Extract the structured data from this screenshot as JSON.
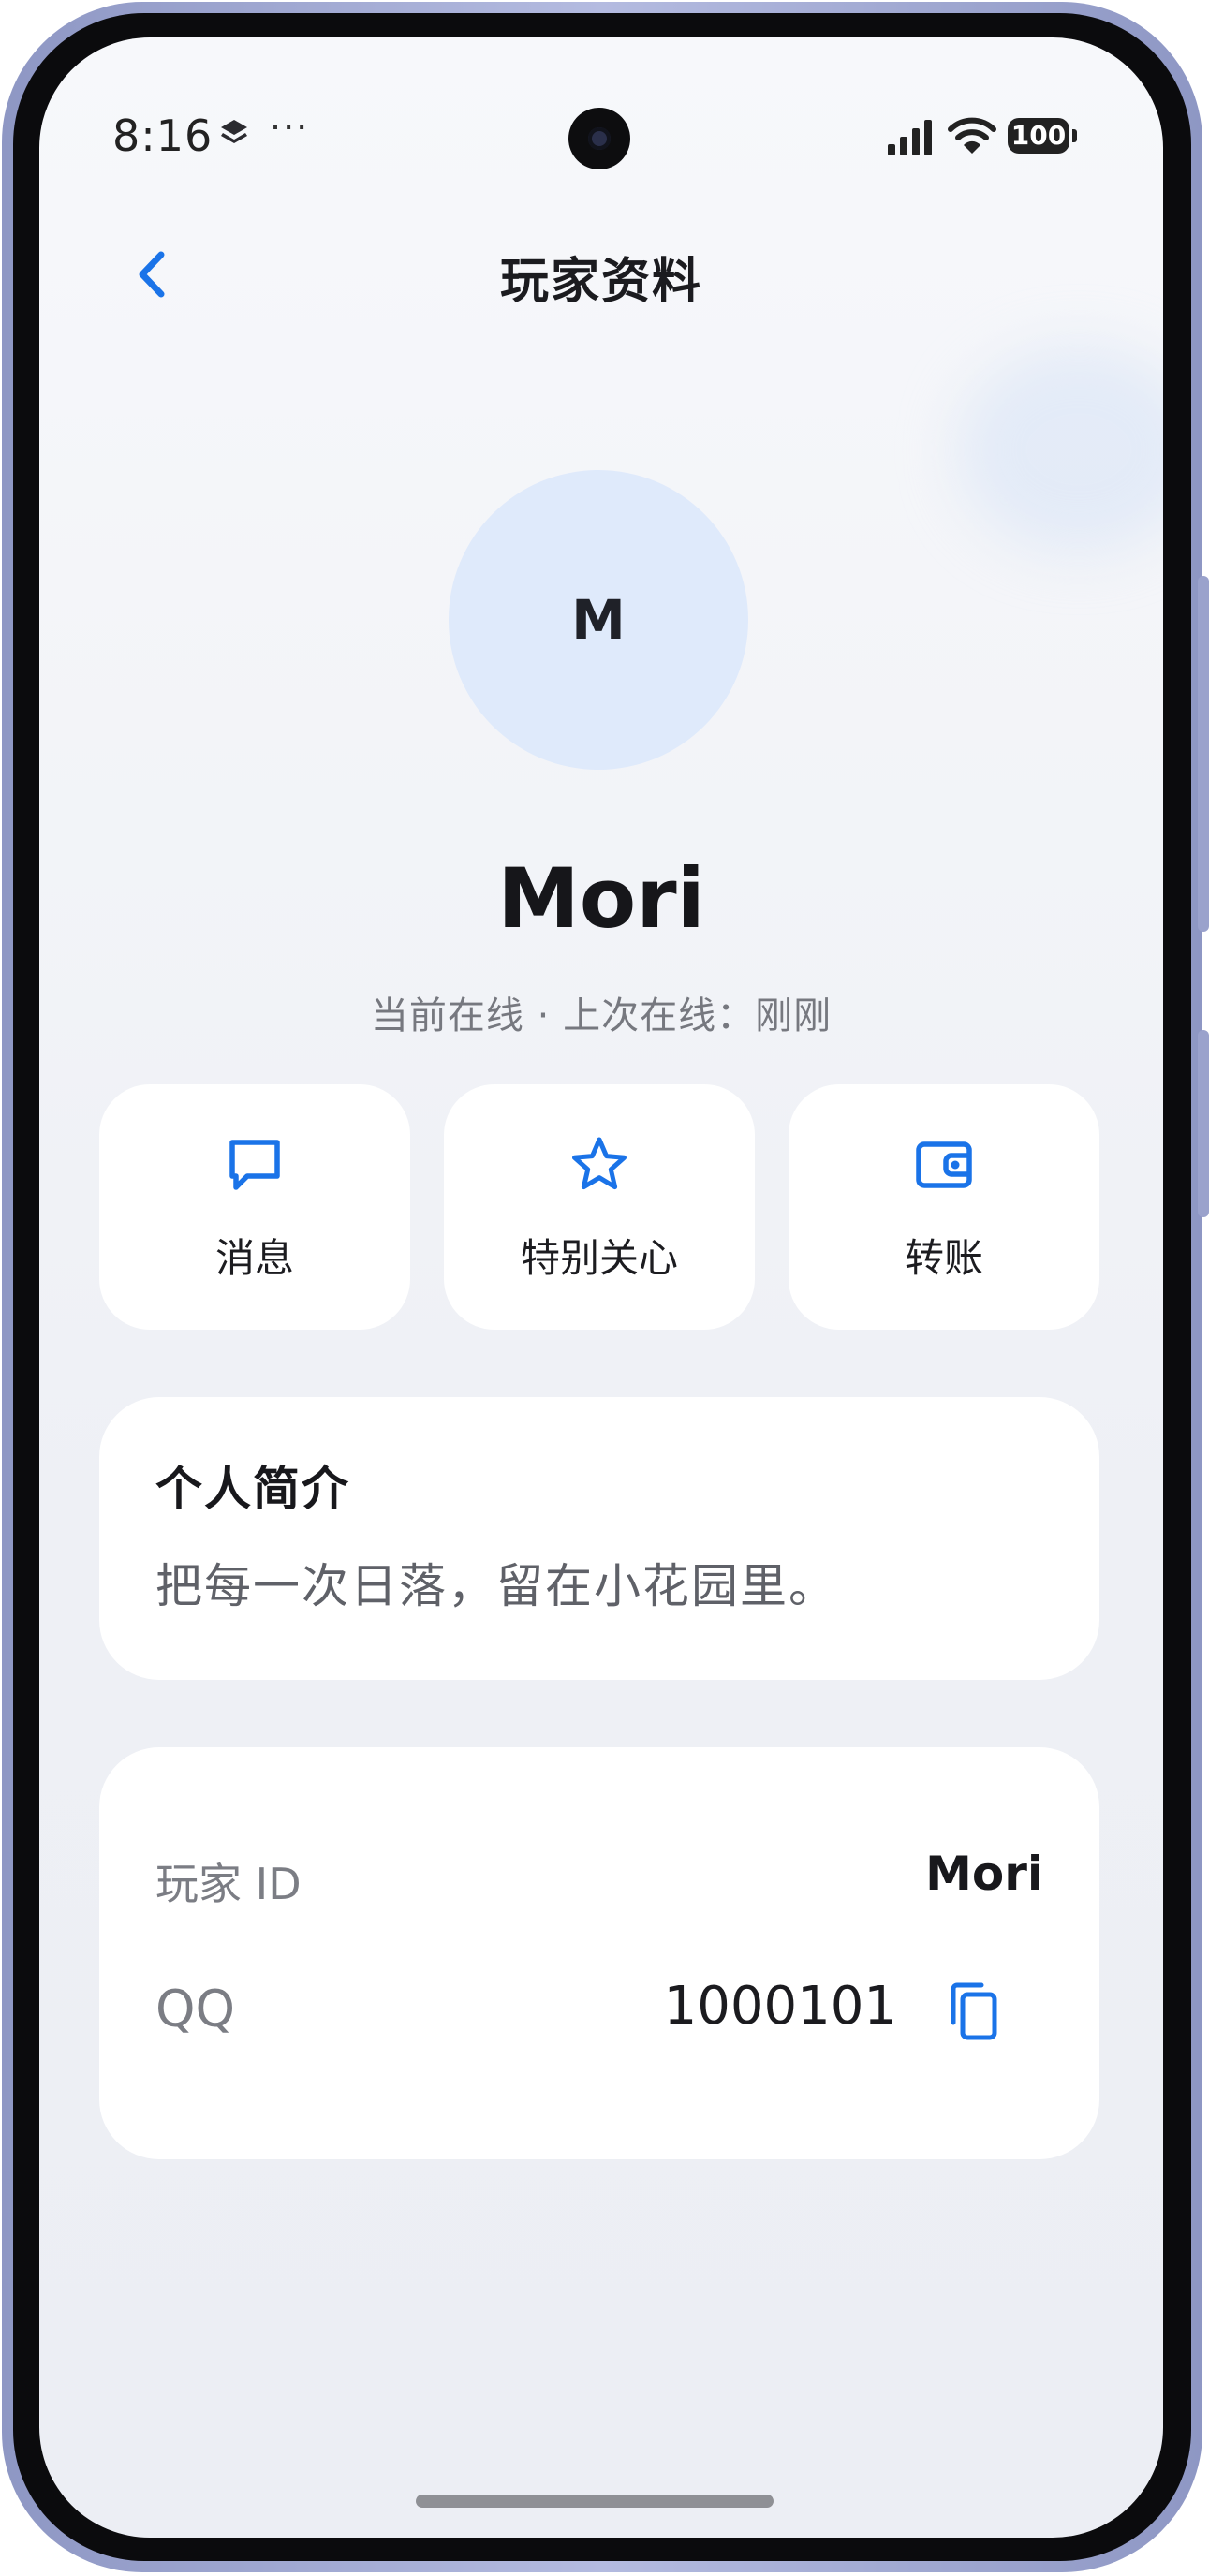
{
  "status_bar": {
    "time": "8:16",
    "more": "···",
    "battery": "100",
    "icons": [
      "layers-icon",
      "signal-icon",
      "wifi-icon",
      "battery-icon"
    ]
  },
  "header": {
    "title": "玩家资料",
    "back_icon": "chevron-left-icon"
  },
  "profile": {
    "avatar_initial": "M",
    "name": "Mori",
    "status": "当前在线 · 上次在线：刚刚"
  },
  "actions": [
    {
      "label": "消息",
      "icon": "message-icon"
    },
    {
      "label": "特别关心",
      "icon": "star-icon"
    },
    {
      "label": "转账",
      "icon": "wallet-icon"
    }
  ],
  "bio": {
    "title": "个人简介",
    "text": "把每一次日落，留在小花园里。"
  },
  "info": {
    "player_id_label": "玩家 ID",
    "player_id_value": "Mori",
    "qq_label": "QQ",
    "qq_value": "1000101",
    "copy_icon": "copy-icon"
  },
  "colors": {
    "accent": "#1a73e8",
    "avatar_bg": "#dfeafb",
    "card_bg": "#ffffff",
    "page_bg": "#f2f3f7",
    "frame": "#a6aedb"
  }
}
